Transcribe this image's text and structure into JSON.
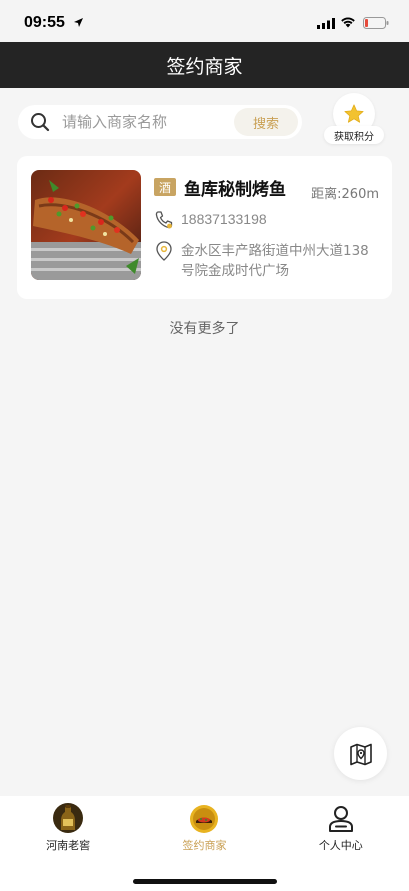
{
  "status_bar": {
    "time": "09:55"
  },
  "header": {
    "title": "签约商家"
  },
  "search": {
    "placeholder": "请输入商家名称",
    "button_label": "搜索"
  },
  "points": {
    "label": "获取积分"
  },
  "merchants": [
    {
      "tag": "酒",
      "name": "鱼库秘制烤鱼",
      "distance": "距离:260m",
      "phone": "18837133198",
      "address": "金水区丰产路街道中州大道138号院金成时代广场"
    }
  ],
  "list_footer": "没有更多了",
  "tabbar": {
    "items": [
      {
        "label": "河南老窖",
        "icon": "bottle-icon"
      },
      {
        "label": "签约商家",
        "icon": "store-badge-icon"
      },
      {
        "label": "个人中心",
        "icon": "person-icon"
      }
    ],
    "active_index": 1
  },
  "colors": {
    "header_bg": "#242424",
    "accent_gold": "#c9a054",
    "tag_bg": "#c8a462",
    "page_bg": "#f5f5f5"
  }
}
